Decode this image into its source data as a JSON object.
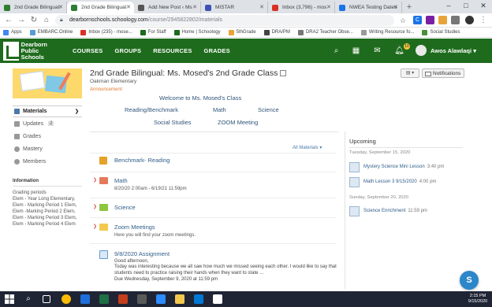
{
  "browser": {
    "tabs": [
      {
        "title": "2nd Grade Bilingual:",
        "color": "#2e7d32",
        "active": false
      },
      {
        "title": "2nd Grade Bilingual",
        "color": "#2e7d32",
        "active": true
      },
      {
        "title": "Add New Post ‹ Ms",
        "color": "#555555",
        "active": false
      },
      {
        "title": "MISTAR",
        "color": "#3f51b5",
        "active": false
      },
      {
        "title": "Inbox (3,796) - mos",
        "color": "#d93025",
        "active": false
      },
      {
        "title": "NWEA Testing Dates",
        "color": "#1a73e8",
        "active": false
      }
    ],
    "new_tab_symbol": "+",
    "window_controls": [
      "–",
      "□",
      "✕"
    ],
    "url_host": "dearbornschools.schoology.com",
    "url_path": "/course/2945822802/materials",
    "bookmarks": [
      {
        "label": "Apps",
        "color": "#4285f4"
      },
      {
        "label": "EMBARC.Online",
        "color": "#5b9bd5"
      },
      {
        "label": "Inbox (235) - mose...",
        "color": "#d93025"
      },
      {
        "label": "For Staff",
        "color": "#1e6b1d"
      },
      {
        "label": "Home | Schoology",
        "color": "#1e6b1d"
      },
      {
        "label": "5thGrade",
        "color": "#e8a33a"
      },
      {
        "label": "DRA/PM",
        "color": "#444444"
      },
      {
        "label": "DRA2 Teacher Obse...",
        "color": "#777777"
      },
      {
        "label": "Writing Resource fo...",
        "color": "#999999"
      },
      {
        "label": "Social Studies",
        "color": "#4a8f3a"
      }
    ]
  },
  "header": {
    "brand_line1": "Dearborn",
    "brand_line2": "Public",
    "brand_line3": "Schools",
    "nav": [
      "COURSES",
      "GROUPS",
      "RESOURCES",
      "GRADES"
    ],
    "notification_count": "10",
    "user_name": "Awos Alawlaqi",
    "user_menu_caret": "▾",
    "accent_color": "#1e6b1d"
  },
  "sidebar": {
    "items": [
      {
        "label": "Materials",
        "active": true
      },
      {
        "label": "Updates",
        "count": "2"
      },
      {
        "label": "Grades"
      },
      {
        "label": "Mastery"
      },
      {
        "label": "Members"
      }
    ],
    "info_title": "Information",
    "grading_periods_label": "Grading periods",
    "grading_periods_text": "Elem - Year Long Elementary, Elem - Marking Period 1 Elem, Elem -Marking Period 2 Elem, Elem - Marking Period 3 Elem, Elem - Marking Period 4 Elem"
  },
  "course": {
    "title": "2nd Grade Bilingual: Ms. Mosed's 2nd Grade Class",
    "school": "Oakman Elementary",
    "announcement_label": "Announcement:",
    "notifications_label": "Notifications",
    "announcement_links": [
      "Welcome to Ms. Mosed's Class",
      "Reading/Benchmark",
      "Math",
      "Science",
      "Social Studies",
      "ZOOM Meeting"
    ]
  },
  "materials": {
    "filter_label": "All Materials",
    "items": [
      {
        "title": "Benchmark- Reading",
        "type": "page",
        "color": "#e5a22a"
      },
      {
        "title": "Math",
        "type": "folder",
        "color": "#e57a5a",
        "dates": "8/20/20 2:00am - 6/19/21 11:59pm",
        "expandable": true
      },
      {
        "title": "Science",
        "type": "folder",
        "color": "#8ec63f",
        "expandable": true
      },
      {
        "title": "Zoom Meetings",
        "type": "folder",
        "color": "#f2c94c",
        "description": "Here you will find your zoom meetings.",
        "expandable": true
      },
      {
        "title": "9/8/2020 Assignment",
        "type": "assignment",
        "color": "#5b9bd5",
        "body_line1": "Good afternoon,",
        "body_line2": "Today was interesting because we all saw how much we missed seeing each other. I would like to say that students need to practice raising their hands when they want to state ...",
        "due": "Due Wednesday, September 9, 2020 at 11:59 pm"
      }
    ]
  },
  "upcoming": {
    "title": "Upcoming",
    "days": [
      {
        "label": "Tuesday, September 15, 2020",
        "events": [
          {
            "title": "Mystery Science Mini Lesson",
            "time": "3:40 pm"
          },
          {
            "title": "Math Lesson 3 9/15/2020",
            "time": "4:00 pm"
          }
        ]
      },
      {
        "label": "Sunday, September 20, 2020",
        "events": [
          {
            "title": "Science Enrichment",
            "time": "11:59 pm"
          }
        ]
      }
    ]
  },
  "help_label": "S",
  "taskbar": {
    "time": "2:15 PM",
    "date": "9/15/2020"
  }
}
